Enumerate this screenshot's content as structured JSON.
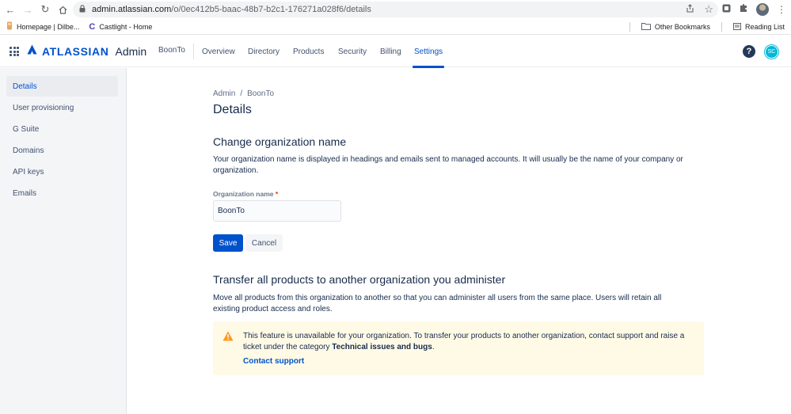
{
  "browser": {
    "url_host": "admin.atlassian.com",
    "url_path": "/o/0ec412b5-baac-48b7-b2c1-176271a028f6/details",
    "bookmarks": [
      "Homepage | Dilbe...",
      "Castlight - Home"
    ],
    "other_bookmarks": "Other Bookmarks",
    "reading_list": "Reading List"
  },
  "topnav": {
    "logo_word": "ATLASSIAN",
    "logo_product": "Admin",
    "org": "BoonTo",
    "items": [
      "Overview",
      "Directory",
      "Products",
      "Security",
      "Billing",
      "Settings"
    ],
    "active": "Settings",
    "avatar_initials": "SC"
  },
  "sidebar": {
    "items": [
      "Details",
      "User provisioning",
      "G Suite",
      "Domains",
      "API keys",
      "Emails"
    ]
  },
  "main": {
    "breadcrumb": [
      "Admin",
      "/",
      "BoonTo"
    ],
    "title": "Details",
    "rename": {
      "title": "Change organization name",
      "description": "Your organization name is displayed in headings and emails sent to managed accounts. It will usually be the name of your company or organization.",
      "label": "Organization name",
      "required_mark": "*",
      "value": "BoonTo",
      "save": "Save",
      "cancel": "Cancel"
    },
    "transfer": {
      "title": "Transfer all products to another organization you administer",
      "description": "Move all products from this organization to another so that you can administer all users from the same place. Users will retain all existing product access and roles.",
      "warning_text": "This feature is unavailable for your organization. To transfer your products to another organization, contact support and raise a ticket under the category",
      "warning_bold": "Technical issues and bugs",
      "warning_end": ".",
      "link": "Contact support"
    }
  },
  "colors": {
    "primary": "#0052cc",
    "warning_bg": "#fffae6",
    "warning_icon": "#ff991f"
  }
}
